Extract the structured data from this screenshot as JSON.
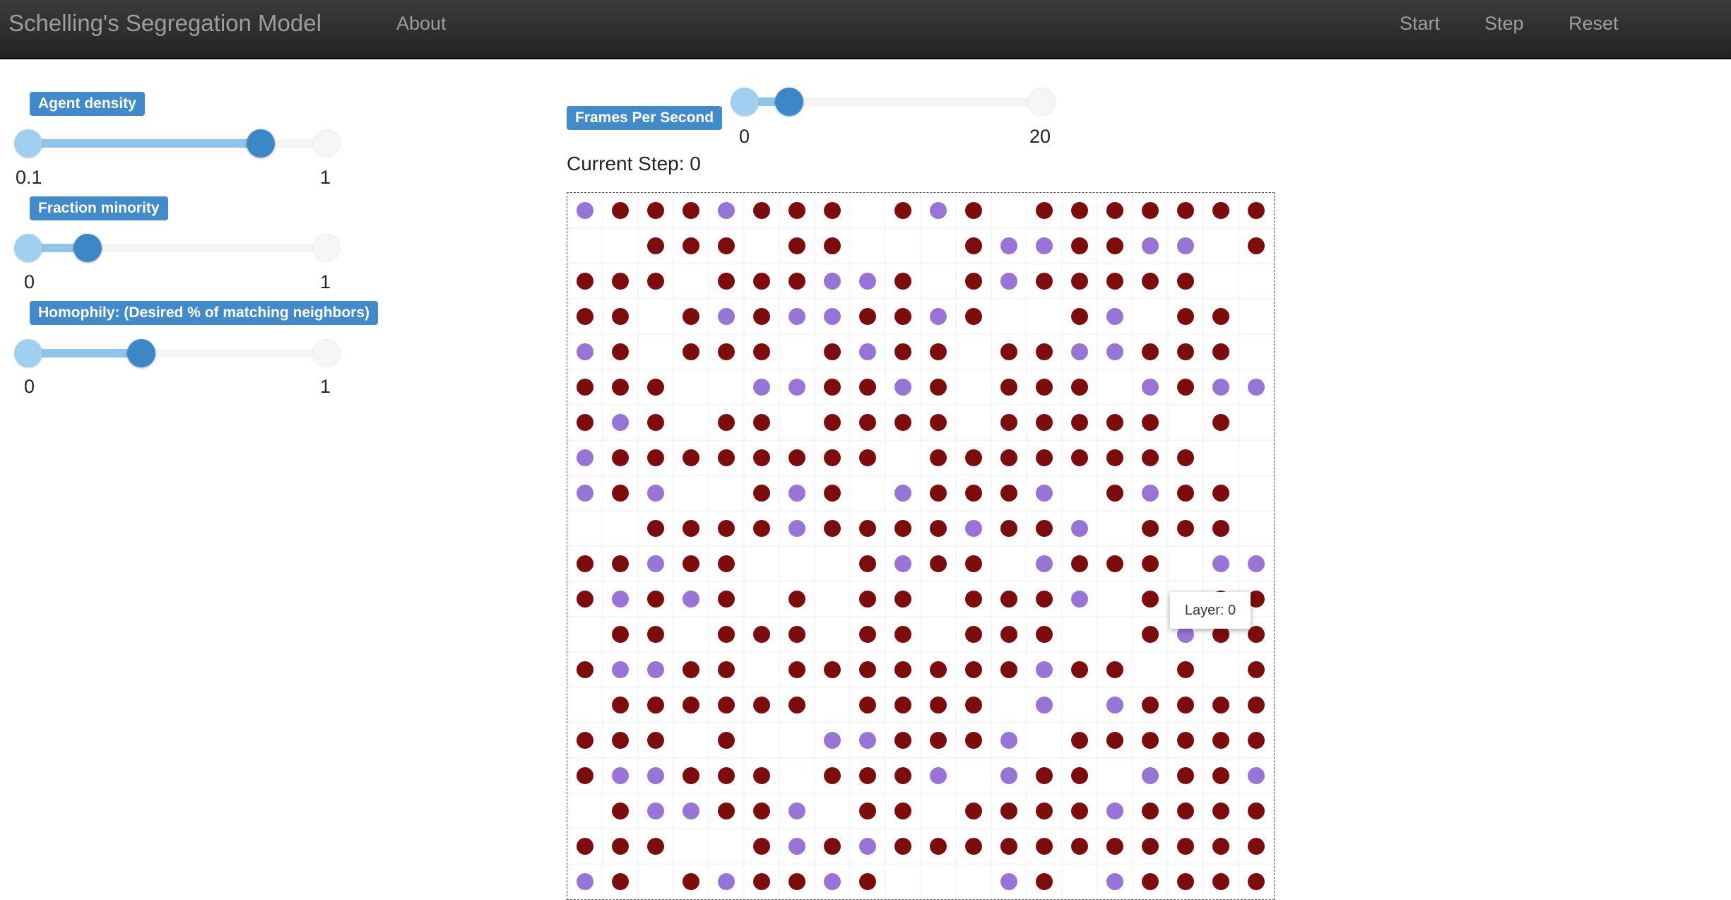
{
  "navbar": {
    "brand": "Schelling's Segregation Model",
    "about": "About",
    "start": "Start",
    "step": "Step",
    "reset": "Reset"
  },
  "controls": {
    "agent_density": {
      "label": "Agent density",
      "min": "0.1",
      "max": "1",
      "value_fraction": 0.78
    },
    "fraction_minority": {
      "label": "Fraction minority",
      "min": "0",
      "max": "1",
      "value_fraction": 0.2
    },
    "homophily": {
      "label": "Homophily: (Desired % of matching neighbors)",
      "min": "0",
      "max": "1",
      "value_fraction": 0.38
    },
    "fps": {
      "label": "Frames Per Second",
      "min": "0",
      "max": "20",
      "value_fraction": 0.15
    }
  },
  "status": {
    "current_step": "Current Step: 0"
  },
  "tooltip": {
    "text": "Layer: 0"
  },
  "colors": {
    "majority": "#7d0c0c",
    "minority": "#9874d6",
    "empty": "#ffffff",
    "accent": "#428bca"
  },
  "legend_key": {
    "M": "majority agent",
    "m": "minority agent",
    ".": "empty cell"
  },
  "grid": {
    "rows": [
      "mMMMmMMM.MmM.MMMMMMM",
      "..MMM.MM...MmmMMmm.M",
      "MMM.MMMmmM.MmMMMMM..",
      "MM.MmMmmMMmM..Mm.MM.",
      "mM.MMM.MmMM.MMmmMMM.",
      "MMM..mmMMmM.MMM.mMmm",
      "MmM.MM.MMMM.MMMMM.M.",
      "mMMMMMMMM.MMMMMMMM..",
      "mMm..MmM.mMMMm.MmMM.",
      "..MMMMmMMMMmMMm.MMM.",
      "MMmMM...MmMM.mMMM.mm",
      "MmMmM.M.MM.MMMm.M.MM",
      ".MM.MMM.MM.MMM..MmMM",
      "MmmMM.MMMMMMMmMM.M.M",
      ".MMMMMM.MMMM.m.mMMMM",
      "MMM.M..mmMMMm.MMMMMM",
      "MmmMMM.MMMm.mMM.mMMm",
      ".MmmMMm.MM.MMMMmMMMM",
      "MMM..MmMmMMMMMMMMMMM",
      "mM.MmMMmM...mM.mMMMM"
    ]
  }
}
